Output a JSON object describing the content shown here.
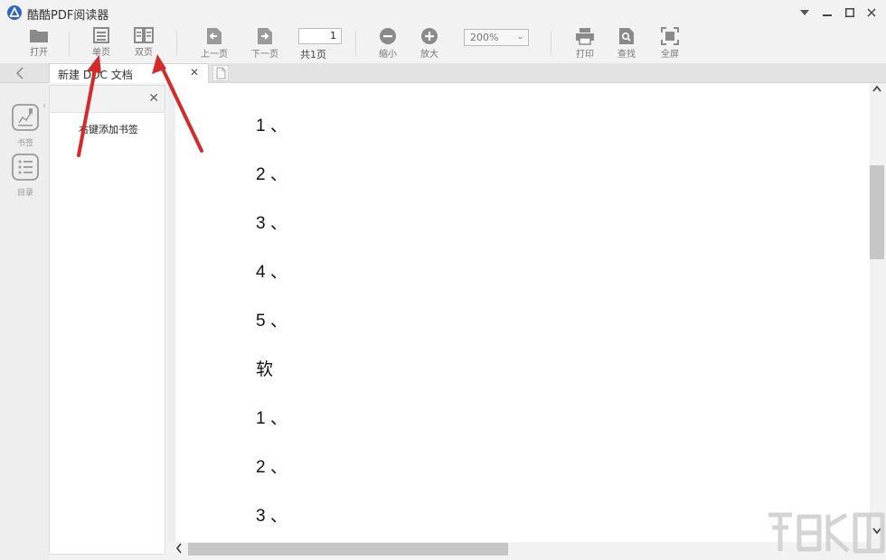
{
  "window": {
    "title": "酷酷PDF阅读器",
    "minimize_icon": "minimize-icon",
    "maximize_icon": "maximize-icon",
    "close_icon": "close-icon",
    "menu_icon": "dropdown-menu-icon"
  },
  "toolbar": {
    "open": "打开",
    "single_page": "单页",
    "double_page": "双页",
    "prev_page": "上一页",
    "next_page": "下一页",
    "current_page": "1",
    "total_pages": "共1页",
    "zoom_out": "缩小",
    "zoom_in": "放大",
    "zoom_level": "200%",
    "print": "打印",
    "find": "查找",
    "fullscreen": "全屏"
  },
  "tabs": [
    {
      "title": "新建 DOC 文档",
      "active": true
    }
  ],
  "rail": {
    "bookmarks": "书签",
    "toc": "目录"
  },
  "bookmark_panel": {
    "hint": "右键添加书签"
  },
  "document": {
    "lines": [
      "1 、",
      "2 、",
      "3 、",
      "4 、",
      "5 、",
      "软",
      "1 、",
      "2 、",
      "3 、"
    ]
  },
  "colors": {
    "accent": "#2f64c4",
    "annotation_arrow": "#d42a2a",
    "icon_gray": "#8a8a8a",
    "chrome_bg": "#f2f2f2"
  }
}
